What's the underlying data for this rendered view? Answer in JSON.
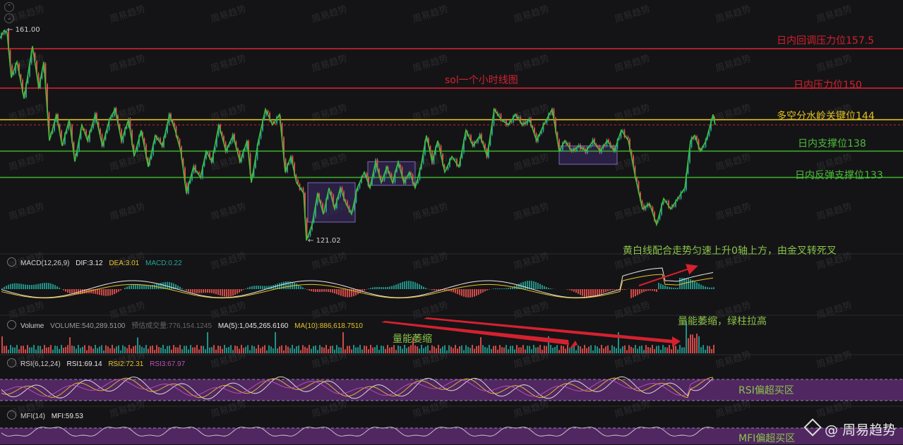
{
  "chart_data": {
    "type": "line",
    "title": "sol一个小时线图",
    "y_high_label": "161.00",
    "y_low_label": "121.02",
    "ylim": [
      118,
      163
    ],
    "price_path": [
      [
        0,
        159.5
      ],
      [
        6,
        161
      ],
      [
        10,
        160.5
      ],
      [
        16,
        152
      ],
      [
        24,
        155
      ],
      [
        34,
        148
      ],
      [
        46,
        158
      ],
      [
        55,
        150
      ],
      [
        62,
        155
      ],
      [
        70,
        140
      ],
      [
        80,
        145
      ],
      [
        88,
        139
      ],
      [
        98,
        144
      ],
      [
        106,
        136
      ],
      [
        116,
        143
      ],
      [
        124,
        140
      ],
      [
        135,
        145
      ],
      [
        145,
        139
      ],
      [
        155,
        144
      ],
      [
        163,
        146
      ],
      [
        172,
        140
      ],
      [
        182,
        144
      ],
      [
        190,
        137
      ],
      [
        200,
        142
      ],
      [
        210,
        135
      ],
      [
        220,
        141
      ],
      [
        230,
        139
      ],
      [
        240,
        145
      ],
      [
        248,
        142
      ],
      [
        256,
        138
      ],
      [
        264,
        130
      ],
      [
        274,
        135
      ],
      [
        284,
        133
      ],
      [
        292,
        138
      ],
      [
        300,
        136
      ],
      [
        310,
        143
      ],
      [
        320,
        138
      ],
      [
        330,
        141
      ],
      [
        340,
        136
      ],
      [
        350,
        140
      ],
      [
        356,
        132
      ],
      [
        366,
        140
      ],
      [
        376,
        146
      ],
      [
        386,
        143
      ],
      [
        396,
        145
      ],
      [
        404,
        134
      ],
      [
        412,
        137
      ],
      [
        420,
        132
      ],
      [
        430,
        130
      ],
      [
        434,
        121
      ],
      [
        442,
        124
      ],
      [
        450,
        130
      ],
      [
        458,
        126
      ],
      [
        466,
        131
      ],
      [
        474,
        127
      ],
      [
        482,
        131
      ],
      [
        490,
        128
      ],
      [
        498,
        126
      ],
      [
        506,
        131
      ],
      [
        516,
        134
      ],
      [
        524,
        131
      ],
      [
        532,
        136
      ],
      [
        540,
        132
      ],
      [
        548,
        135
      ],
      [
        556,
        132
      ],
      [
        564,
        136
      ],
      [
        572,
        132
      ],
      [
        580,
        134
      ],
      [
        588,
        131
      ],
      [
        596,
        135
      ],
      [
        604,
        141
      ],
      [
        612,
        136
      ],
      [
        620,
        140
      ],
      [
        630,
        134
      ],
      [
        640,
        137
      ],
      [
        650,
        135
      ],
      [
        660,
        142
      ],
      [
        670,
        139
      ],
      [
        680,
        141
      ],
      [
        690,
        137
      ],
      [
        700,
        146
      ],
      [
        710,
        144
      ],
      [
        720,
        143
      ],
      [
        730,
        145
      ],
      [
        740,
        143
      ],
      [
        750,
        144
      ],
      [
        760,
        140
      ],
      [
        770,
        143
      ],
      [
        782,
        146
      ],
      [
        792,
        138
      ],
      [
        800,
        140
      ],
      [
        810,
        138
      ],
      [
        820,
        139
      ],
      [
        830,
        138
      ],
      [
        840,
        140
      ],
      [
        850,
        138
      ],
      [
        860,
        140
      ],
      [
        870,
        138
      ],
      [
        880,
        142
      ],
      [
        890,
        140
      ],
      [
        900,
        133
      ],
      [
        910,
        127
      ],
      [
        920,
        128
      ],
      [
        930,
        124
      ],
      [
        940,
        129
      ],
      [
        950,
        127
      ],
      [
        960,
        129
      ],
      [
        970,
        131
      ],
      [
        978,
        140
      ],
      [
        984,
        141
      ],
      [
        992,
        138
      ],
      [
        1000,
        140
      ],
      [
        1010,
        145
      ],
      [
        1013,
        143
      ]
    ],
    "levels": [
      {
        "label": "日内回调压力位157.5",
        "value": 157.5,
        "color": "#d4212f"
      },
      {
        "label": "日内压力位150",
        "value": 150,
        "color": "#d4212f"
      },
      {
        "label": "多空分水岭关键位144",
        "value": 144,
        "color": "#e0c020"
      },
      {
        "label": "日内支撑位138",
        "value": 138,
        "color": "#3aa82a"
      },
      {
        "label": "日内反弹支撑位133",
        "value": 133,
        "color": "#3aa82a"
      }
    ],
    "current_price_guide": 143,
    "consolidation_boxes": [
      {
        "x_from": 436,
        "x_to": 503,
        "y_from": 132,
        "y_to": 124.5
      },
      {
        "x_from": 521,
        "x_to": 588,
        "y_from": 136,
        "y_to": 131.5
      },
      {
        "x_from": 792,
        "x_to": 874,
        "y_from": 139,
        "y_to": 135.5
      }
    ],
    "indicators": {
      "macd": {
        "name": "MACD(12,26,9)",
        "dif": "DIF:3.12",
        "dea": "DEA:3.01",
        "macd": "MACD:0.22"
      },
      "volume": {
        "name": "Volume",
        "volume": "VOLUME:540,289.5100",
        "forecast": "预估成交量:776,154.1245",
        "ma5": "MA(5):1,045,265.6160",
        "ma10": "MA(10):886,618.7510"
      },
      "rsi": {
        "name": "RSI(6,12,24)",
        "rsi1": "RSI1:69.14",
        "rsi2": "RSI2:72.31",
        "rsi3": "RSI3:67.97"
      },
      "mfi": {
        "name": "MFI(14)",
        "mfi": "MFI:59.53"
      }
    },
    "annotations": {
      "macd_note": "黄白线配合走势匀速上升0轴上方，由金叉转死叉",
      "volume_note_1": "量能萎缩",
      "volume_note_2": "量能萎缩，绿柱拉高",
      "rsi_note": "RSI偏超买区",
      "mfi_note": "MFI偏超买区"
    },
    "watermark": "周易趋势",
    "brand": "@ 周易趋势"
  },
  "colors": {
    "bg": "#141416",
    "up": "#26a69a",
    "down": "#ef5350",
    "yellow": "#e6c229",
    "white": "#e8e8e8",
    "purple": "#5a2a6e",
    "annot_green": "#8bc34a",
    "annot_red": "#d4212f"
  }
}
